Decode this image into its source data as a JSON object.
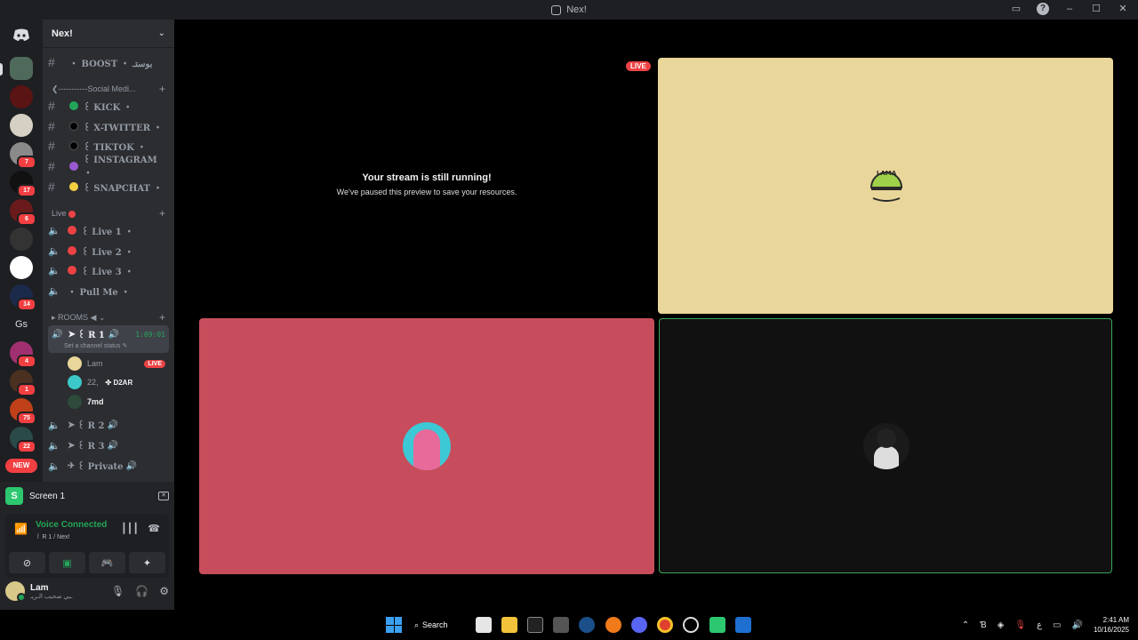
{
  "window": {
    "title": "Nex!"
  },
  "rail": {
    "badges": [
      "7",
      "17",
      "6",
      "14",
      "4",
      "1",
      "75",
      "22"
    ],
    "text_server": "Gs",
    "new_label": "NEW"
  },
  "server": {
    "name": "Nex!"
  },
  "channels": [
    {
      "name": "・ BOOST ・ بوستـ",
      "dot": ""
    },
    {
      "name": "꒰ KICK ・",
      "dot": "#23a559"
    },
    {
      "name": "꒰ X-TWITTER ・",
      "dot": "#000000"
    },
    {
      "name": "꒰ TIKTOK ・",
      "dot": "#000000"
    },
    {
      "name": "꒰ INSTAGRAM ・",
      "dot": "#9b59d0"
    },
    {
      "name": "꒰ SNAPCHAT ・",
      "dot": "#f5d142"
    }
  ],
  "categories": {
    "social": "❮-----------Social Medi...",
    "live": "Live",
    "rooms": "ROOMS ◀"
  },
  "live_channels": [
    "꒰ Live 1 ・",
    "꒰ Live 2 ・",
    "꒰ Live 3 ・"
  ],
  "pull_me": "・ Pull Me ・",
  "active_voice": {
    "name": "꒰ R 1",
    "time": "1:09:01",
    "status": "Set a channel status"
  },
  "voice_users": [
    {
      "name": "Lam",
      "live": "LIVE"
    },
    {
      "name": "22,",
      "tag": "D2AR"
    },
    {
      "name": "7md"
    }
  ],
  "rooms": [
    "꒰ R 2",
    "꒰ R 3",
    "꒰ Private"
  ],
  "panel": {
    "screen_label": "Screen 1",
    "vc_title": "Voice Connected",
    "vc_sub": "꒰ R 1 / Nex!",
    "user_name": "Lam",
    "user_status": "ـبي صحبب الـريـ"
  },
  "stage": {
    "paused_title": "Your stream is still running!",
    "paused_sub": "We've paused this preview to save your resources.",
    "live_badge": "LIVE",
    "tiles": [
      {
        "bg": "#e9d69a"
      },
      {
        "bg": "#c84d5c"
      },
      {
        "bg": "#111111"
      }
    ]
  },
  "taskbar": {
    "search": "Search",
    "time": "2:41 AM",
    "date": "10/16/2025",
    "lang": "ع"
  }
}
